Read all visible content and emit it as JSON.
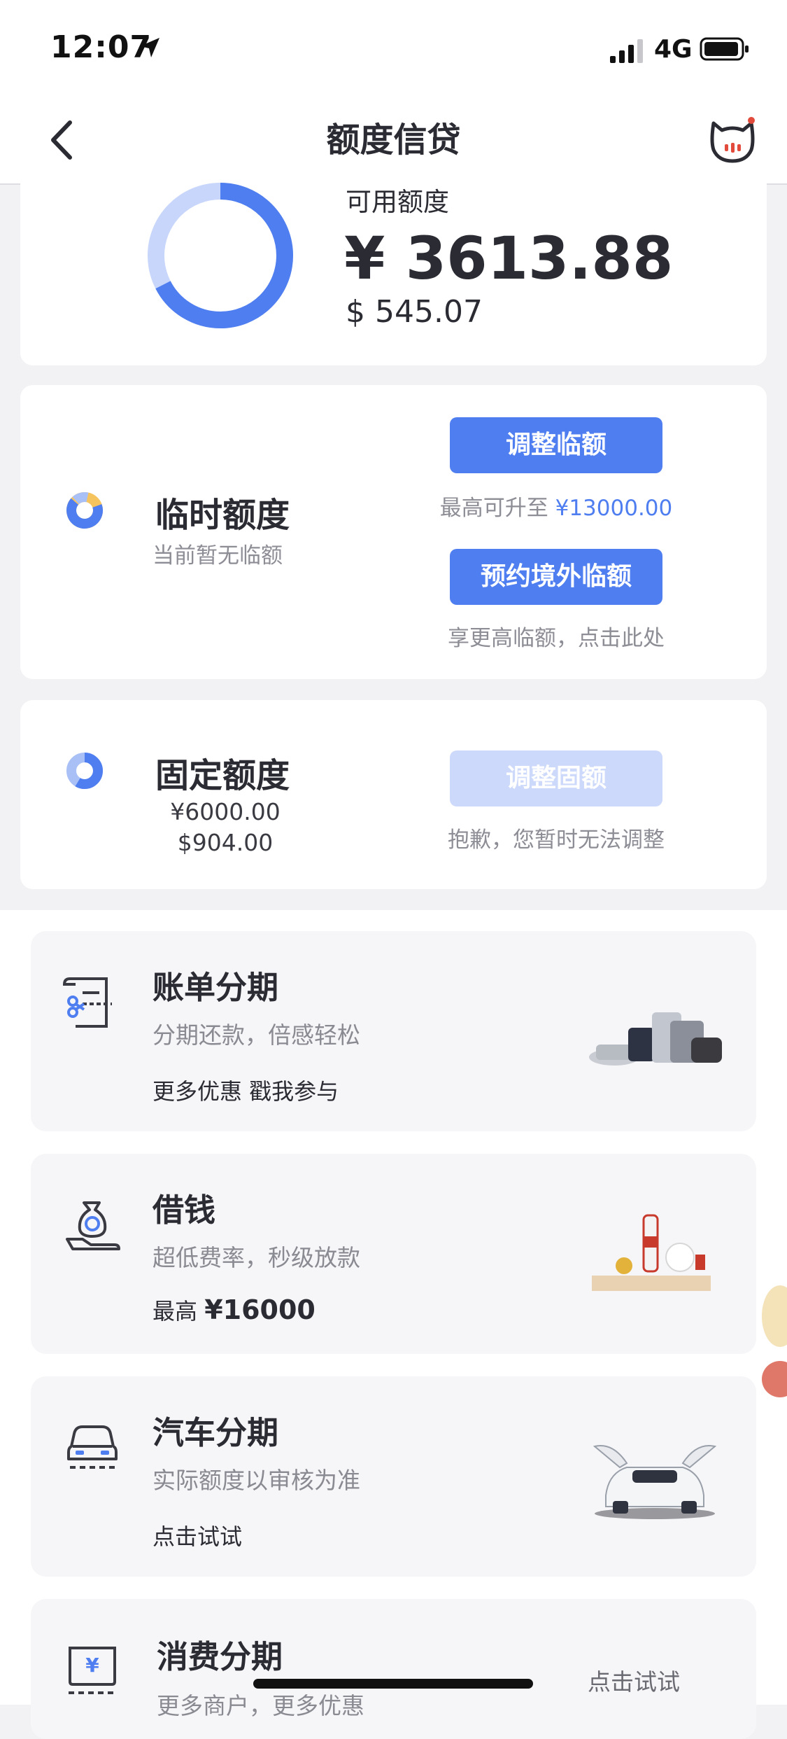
{
  "status_bar": {
    "time": "12:07",
    "network": "4G"
  },
  "nav": {
    "title": "额度信贷"
  },
  "available": {
    "label": "可用额度",
    "cny": "¥ 3613.88",
    "usd": "$ 545.07"
  },
  "temp_credit": {
    "title": "临时额度",
    "subtitle": "当前暂无临额",
    "adjust_button": "调整临额",
    "max_hint_prefix": "最高可升至 ",
    "max_hint_value": "¥13000.00",
    "overseas_button": "预约境外临额",
    "overseas_hint": "享更高临额，点击此处"
  },
  "fixed_credit": {
    "title": "固定额度",
    "cny": "¥6000.00",
    "usd": "$904.00",
    "adjust_button": "调整固额",
    "hint": "抱歉，您暂时无法调整"
  },
  "products": [
    {
      "title": "账单分期",
      "subtitle": "分期还款，倍感轻松",
      "note": "更多优惠 戳我参与"
    },
    {
      "title": "借钱",
      "subtitle": "超低费率，秒级放款",
      "note_prefix": "最高 ",
      "note_value": "¥16000"
    },
    {
      "title": "汽车分期",
      "subtitle": "实际额度以审核为准",
      "note": "点击试试"
    },
    {
      "title": "消费分期",
      "subtitle": "更多商户，更多优惠",
      "note": "点击试试"
    }
  ],
  "colors": {
    "accent": "#4f7ef0",
    "accent_light": "#cdd9fb",
    "page_bg": "#f2f2f4"
  }
}
